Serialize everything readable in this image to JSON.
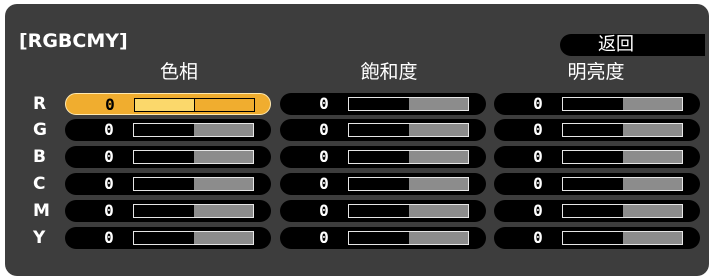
{
  "panel": {
    "title": "[RGBCMY]",
    "back_label": "返回",
    "columns": [
      "色相",
      "飽和度",
      "明亮度"
    ],
    "rows": [
      {
        "label": "R",
        "values": [
          "0",
          "0",
          "0"
        ],
        "levels": [
          0.5,
          0.5,
          0.5
        ]
      },
      {
        "label": "G",
        "values": [
          "0",
          "0",
          "0"
        ],
        "levels": [
          0.5,
          0.5,
          0.5
        ]
      },
      {
        "label": "B",
        "values": [
          "0",
          "0",
          "0"
        ],
        "levels": [
          0.5,
          0.5,
          0.5
        ]
      },
      {
        "label": "C",
        "values": [
          "0",
          "0",
          "0"
        ],
        "levels": [
          0.5,
          0.5,
          0.5
        ]
      },
      {
        "label": "M",
        "values": [
          "0",
          "0",
          "0"
        ],
        "levels": [
          0.5,
          0.5,
          0.5
        ]
      },
      {
        "label": "Y",
        "values": [
          "0",
          "0",
          "0"
        ],
        "levels": [
          0.5,
          0.5,
          0.5
        ]
      }
    ],
    "selected": {
      "row": 0,
      "column": 0
    }
  },
  "colors": {
    "panel_background": "#3d3d3d",
    "control_background": "#000000",
    "selected_highlight": "#f0ad2f",
    "track": "#8c8c8c",
    "text": "#ffffff"
  }
}
